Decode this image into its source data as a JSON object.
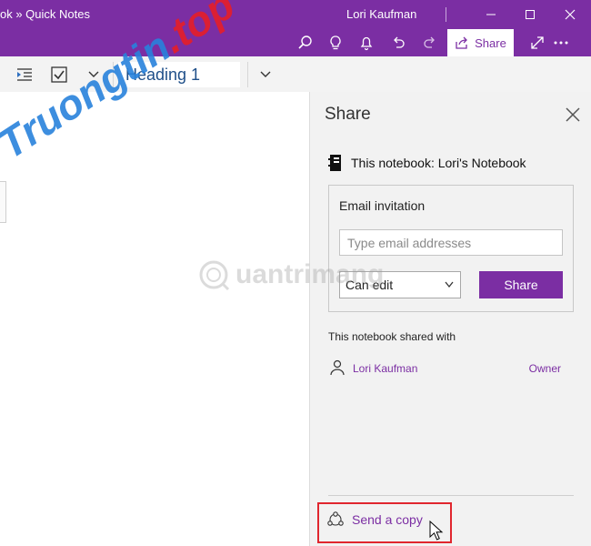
{
  "titlebar": {
    "breadcrumb": "ok » Quick Notes",
    "user": "Lori Kaufman",
    "share_label": "Share"
  },
  "ribbon": {
    "style_value": "Heading 1"
  },
  "share_pane": {
    "title": "Share",
    "notebook_label": "This notebook: Lori's Notebook",
    "invite": {
      "title": "Email invitation",
      "email_placeholder": "Type email addresses",
      "permission": "Can edit",
      "share_button": "Share"
    },
    "shared_with_label": "This notebook shared with",
    "owner": {
      "name": "Lori Kaufman",
      "role": "Owner"
    },
    "send_copy": "Send a copy"
  },
  "watermark": {
    "text_main": "Truongtin",
    "text_tld": ".top",
    "text_secondary": "uantrimang"
  },
  "colors": {
    "accent": "#7b2ea3",
    "highlight": "#e0262e"
  }
}
